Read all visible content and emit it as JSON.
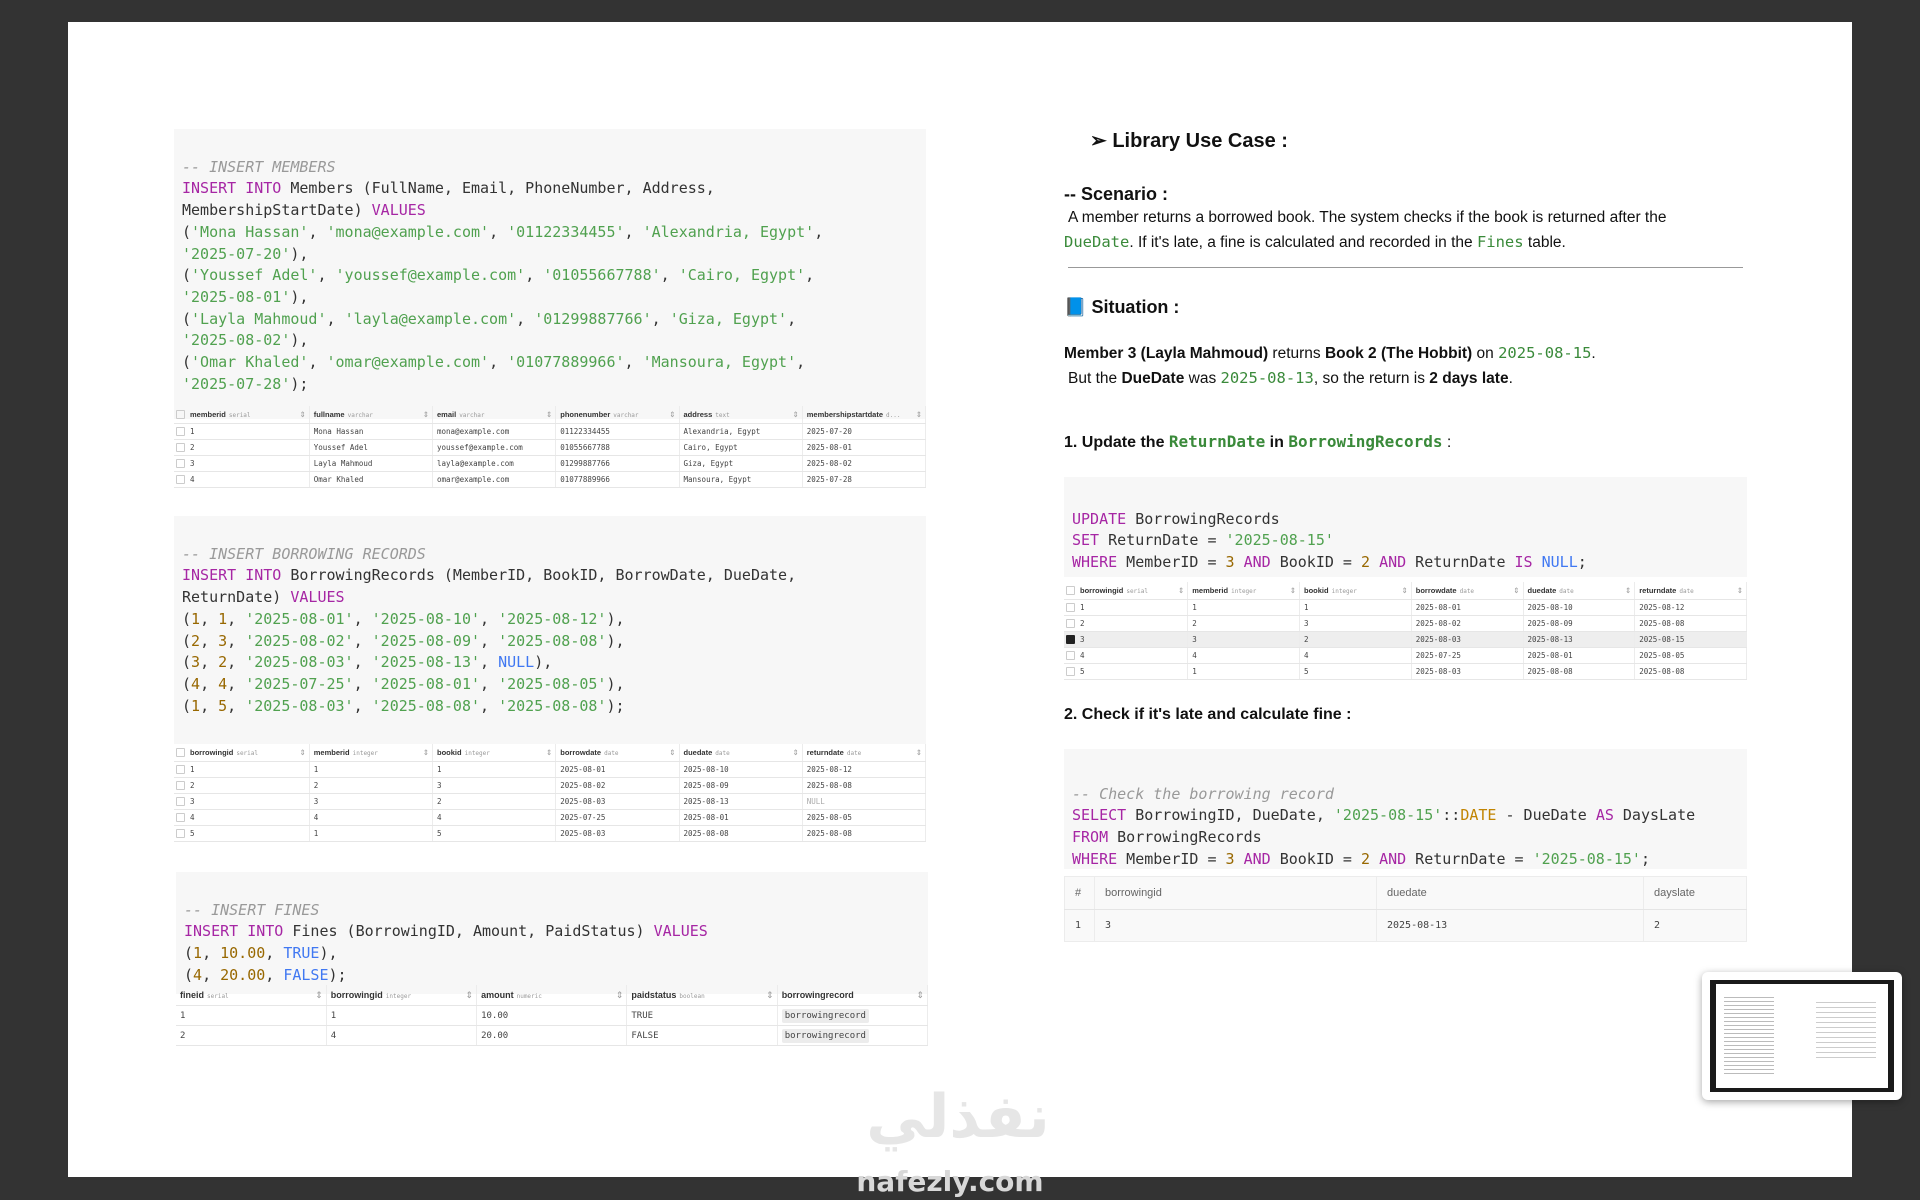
{
  "members_sql": {
    "comment": "-- INSERT MEMBERS",
    "line1_kw": "INSERT INTO",
    "line1_rest": " Members (FullName, Email, PhoneNumber, Address,",
    "line2_rest": "MembershipStartDate) ",
    "line2_kw": "VALUES",
    "rows": [
      {
        "a": "'Mona Hassan'",
        "b": "'mona@example.com'",
        "c": "'01122334455'",
        "d": "'Alexandria, Egypt'",
        "e": "'2025-07-20'"
      },
      {
        "a": "'Youssef Adel'",
        "b": "'youssef@example.com'",
        "c": "'01055667788'",
        "d": "'Cairo, Egypt'",
        "e": "'2025-08-01'"
      },
      {
        "a": "'Layla Mahmoud'",
        "b": "'layla@example.com'",
        "c": "'01299887766'",
        "d": "'Giza, Egypt'",
        "e": "'2025-08-02'"
      },
      {
        "a": "'Omar Khaled'",
        "b": "'omar@example.com'",
        "c": "'01077889966'",
        "d": "'Mansoura, Egypt'",
        "e": "'2025-07-28'"
      }
    ]
  },
  "members_table": {
    "columns": [
      {
        "name": "memberid",
        "type": "serial"
      },
      {
        "name": "fullname",
        "type": "varchar"
      },
      {
        "name": "email",
        "type": "varchar"
      },
      {
        "name": "phonenumber",
        "type": "varchar"
      },
      {
        "name": "address",
        "type": "text"
      },
      {
        "name": "membershipstartdate",
        "type": "d..."
      }
    ],
    "rows": [
      [
        "1",
        "Mona Hassan",
        "mona@example.com",
        "01122334455",
        "Alexandria, Egypt",
        "2025-07-20"
      ],
      [
        "2",
        "Youssef Adel",
        "youssef@example.com",
        "01055667788",
        "Cairo, Egypt",
        "2025-08-01"
      ],
      [
        "3",
        "Layla Mahmoud",
        "layla@example.com",
        "01299887766",
        "Giza, Egypt",
        "2025-08-02"
      ],
      [
        "4",
        "Omar Khaled",
        "omar@example.com",
        "01077889966",
        "Mansoura, Egypt",
        "2025-07-28"
      ]
    ]
  },
  "borrowing_sql": {
    "comment": "-- INSERT BORROWING RECORDS",
    "line1_kw": "INSERT INTO",
    "line1_rest": " BorrowingRecords (MemberID, BookID, BorrowDate, DueDate,",
    "line2_rest": "ReturnDate) ",
    "line2_kw": "VALUES",
    "rows": [
      {
        "m": "1",
        "b": "1",
        "bd": "'2025-08-01'",
        "dd": "'2025-08-10'",
        "rd": "'2025-08-12'"
      },
      {
        "m": "2",
        "b": "3",
        "bd": "'2025-08-02'",
        "dd": "'2025-08-09'",
        "rd": "'2025-08-08'"
      },
      {
        "m": "3",
        "b": "2",
        "bd": "'2025-08-03'",
        "dd": "'2025-08-13'",
        "rd": "NULL"
      },
      {
        "m": "4",
        "b": "4",
        "bd": "'2025-07-25'",
        "dd": "'2025-08-01'",
        "rd": "'2025-08-05'"
      },
      {
        "m": "1",
        "b": "5",
        "bd": "'2025-08-03'",
        "dd": "'2025-08-08'",
        "rd": "'2025-08-08'"
      }
    ]
  },
  "borrowing_table": {
    "columns": [
      {
        "name": "borrowingid",
        "type": "serial"
      },
      {
        "name": "memberid",
        "type": "integer"
      },
      {
        "name": "bookid",
        "type": "integer"
      },
      {
        "name": "borrowdate",
        "type": "date"
      },
      {
        "name": "duedate",
        "type": "date"
      },
      {
        "name": "returndate",
        "type": "date"
      }
    ],
    "rows": [
      [
        "1",
        "1",
        "1",
        "2025-08-01",
        "2025-08-10",
        "2025-08-12"
      ],
      [
        "2",
        "2",
        "3",
        "2025-08-02",
        "2025-08-09",
        "2025-08-08"
      ],
      [
        "3",
        "3",
        "2",
        "2025-08-03",
        "2025-08-13",
        "NULL"
      ],
      [
        "4",
        "4",
        "4",
        "2025-07-25",
        "2025-08-01",
        "2025-08-05"
      ],
      [
        "5",
        "1",
        "5",
        "2025-08-03",
        "2025-08-08",
        "2025-08-08"
      ]
    ]
  },
  "fines_sql": {
    "comment": "-- INSERT FINES",
    "line1_kw": "INSERT INTO",
    "line1_rest": " Fines (BorrowingID, Amount, PaidStatus) ",
    "line1_kw2": "VALUES",
    "rows": [
      {
        "id": "1",
        "amt": "10.00",
        "paid": "TRUE",
        "end": "),"
      },
      {
        "id": "4",
        "amt": "20.00",
        "paid": "FALSE",
        "end": ");"
      }
    ]
  },
  "fines_table": {
    "columns": [
      {
        "name": "fineid",
        "type": "serial"
      },
      {
        "name": "borrowingid",
        "type": "integer"
      },
      {
        "name": "amount",
        "type": "numeric"
      },
      {
        "name": "paidstatus",
        "type": "boolean"
      },
      {
        "name": "borrowingrecord",
        "type": ""
      }
    ],
    "rows": [
      [
        "1",
        "1",
        "10.00",
        "TRUE",
        "borrowingrecord"
      ],
      [
        "2",
        "4",
        "20.00",
        "FALSE",
        "borrowingrecord"
      ]
    ]
  },
  "right": {
    "title": "➢ Library Use Case :",
    "scenario_heading": "-- Scenario :",
    "scenario_line1": "A member returns a borrowed book. The system checks if the book is returned after the",
    "scenario_due": "DueDate",
    "scenario_mid": ". If it's late, a fine is calculated and recorded in the ",
    "scenario_fines": "Fines",
    "scenario_end": " table.",
    "situation_icon": "📘",
    "situation_heading": "Situation :",
    "sit1_a": "Member 3 (Layla Mahmoud)",
    "sit1_b": " returns ",
    "sit1_c": "Book 2 (The Hobbit)",
    "sit1_d": " on ",
    "sit1_date": "2025-08-15",
    "sit1_e": ".",
    "sit2_a": "But the ",
    "sit2_b": "DueDate",
    "sit2_c": " was ",
    "sit2_date": "2025-08-13",
    "sit2_d": ", so the return is ",
    "sit2_e": "2 days late",
    "sit2_f": ".",
    "step1_a": "1. Update the ",
    "step1_b": "ReturnDate",
    "step1_c": " in ",
    "step1_d": "BorrowingRecords",
    "step1_e": "  :",
    "update_sql": {
      "l1_kw": "UPDATE",
      "l1_rest": " BorrowingRecords",
      "l2_kw": "SET",
      "l2_rest": " ReturnDate = ",
      "l2_str": "'2025-08-15'",
      "l3_kw": "WHERE",
      "l3_a": " MemberID = ",
      "l3_n1": "3",
      "l3_and1": "AND",
      "l3_b": " BookID = ",
      "l3_n2": "2",
      "l3_and2": "AND",
      "l3_c": " ReturnDate ",
      "l3_is": "IS",
      "l3_null": "NULL",
      "l3_end": ";"
    },
    "updated_table": {
      "columns": [
        {
          "name": "borrowingid",
          "type": "serial"
        },
        {
          "name": "memberid",
          "type": "integer"
        },
        {
          "name": "bookid",
          "type": "integer"
        },
        {
          "name": "borrowdate",
          "type": "date"
        },
        {
          "name": "duedate",
          "type": "date"
        },
        {
          "name": "returndate",
          "type": "date"
        }
      ],
      "rows": [
        [
          "1",
          "1",
          "1",
          "2025-08-01",
          "2025-08-10",
          "2025-08-12"
        ],
        [
          "2",
          "2",
          "3",
          "2025-08-02",
          "2025-08-09",
          "2025-08-08"
        ],
        [
          "3",
          "3",
          "2",
          "2025-08-03",
          "2025-08-13",
          "2025-08-15"
        ],
        [
          "4",
          "4",
          "4",
          "2025-07-25",
          "2025-08-01",
          "2025-08-05"
        ],
        [
          "5",
          "1",
          "5",
          "2025-08-03",
          "2025-08-08",
          "2025-08-08"
        ]
      ],
      "selected_row": 2
    },
    "step2": "2. Check if it's late and calculate fine :",
    "check_sql": {
      "comment": "-- Check the borrowing record",
      "l1_kw": "SELECT",
      "l1_a": " BorrowingID, DueDate, ",
      "l1_str": "'2025-08-15'",
      "l1_cast": "::",
      "l1_type": "DATE",
      "l1_b": " - DueDate ",
      "l1_as": "AS",
      "l1_c": " DaysLate",
      "l2_kw": "FROM",
      "l2_rest": " BorrowingRecords",
      "l3_kw": "WHERE",
      "l3_a": " MemberID = ",
      "l3_n1": "3",
      "l3_and1": "AND",
      "l3_b": " BookID = ",
      "l3_n2": "2",
      "l3_and2": "AND",
      "l3_c": " ReturnDate = ",
      "l3_str": "'2025-08-15'",
      "l3_end": ";"
    },
    "result_table": {
      "columns": [
        "#",
        "borrowingid",
        "duedate",
        "dayslate"
      ],
      "rows": [
        [
          "1",
          "3",
          "2025-08-13",
          "2"
        ]
      ]
    }
  },
  "watermark": {
    "arabic": "نفذلي",
    "latin": "nafezly.com"
  }
}
